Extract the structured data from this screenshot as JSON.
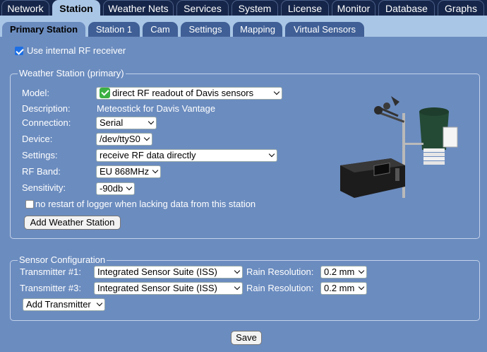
{
  "top_tabs": [
    "Network",
    "Station",
    "Weather Nets",
    "Services",
    "System",
    "License",
    "Monitor",
    "Database",
    "Graphs"
  ],
  "sub_tabs": [
    "Primary Station",
    "Station 1",
    "Cam",
    "Settings",
    "Mapping",
    "Virtual Sensors"
  ],
  "use_internal_rf_label": "Use internal RF receiver",
  "weather_station": {
    "legend": "Weather Station (primary)",
    "model_label": "Model:",
    "model_value": "direct RF readout of Davis sensors",
    "description_label": "Description:",
    "description_value": "Meteostick for Davis Vantage",
    "connection_label": "Connection:",
    "connection_value": "Serial",
    "device_label": "Device:",
    "device_value": "/dev/ttyS0",
    "settings_label": "Settings:",
    "settings_value": "receive RF data directly",
    "rfband_label": "RF Band:",
    "rfband_value": "EU 868MHz",
    "sensitivity_label": "Sensitivity:",
    "sensitivity_value": "-90db",
    "no_restart_label": "no restart of logger when lacking data from this station",
    "add_station_button": "Add Weather Station"
  },
  "sensor_config": {
    "legend": "Sensor Configuration",
    "rows": [
      {
        "label": "Transmitter #1:",
        "value": "Integrated Sensor Suite (ISS)",
        "rain_label": "Rain Resolution:",
        "rain_value": "0.2 mm"
      },
      {
        "label": "Transmitter #3:",
        "value": "Integrated Sensor Suite (ISS)",
        "rain_label": "Rain Resolution:",
        "rain_value": "0.2 mm"
      }
    ],
    "add_transmitter": "Add Transmitter"
  },
  "save_button": "Save"
}
